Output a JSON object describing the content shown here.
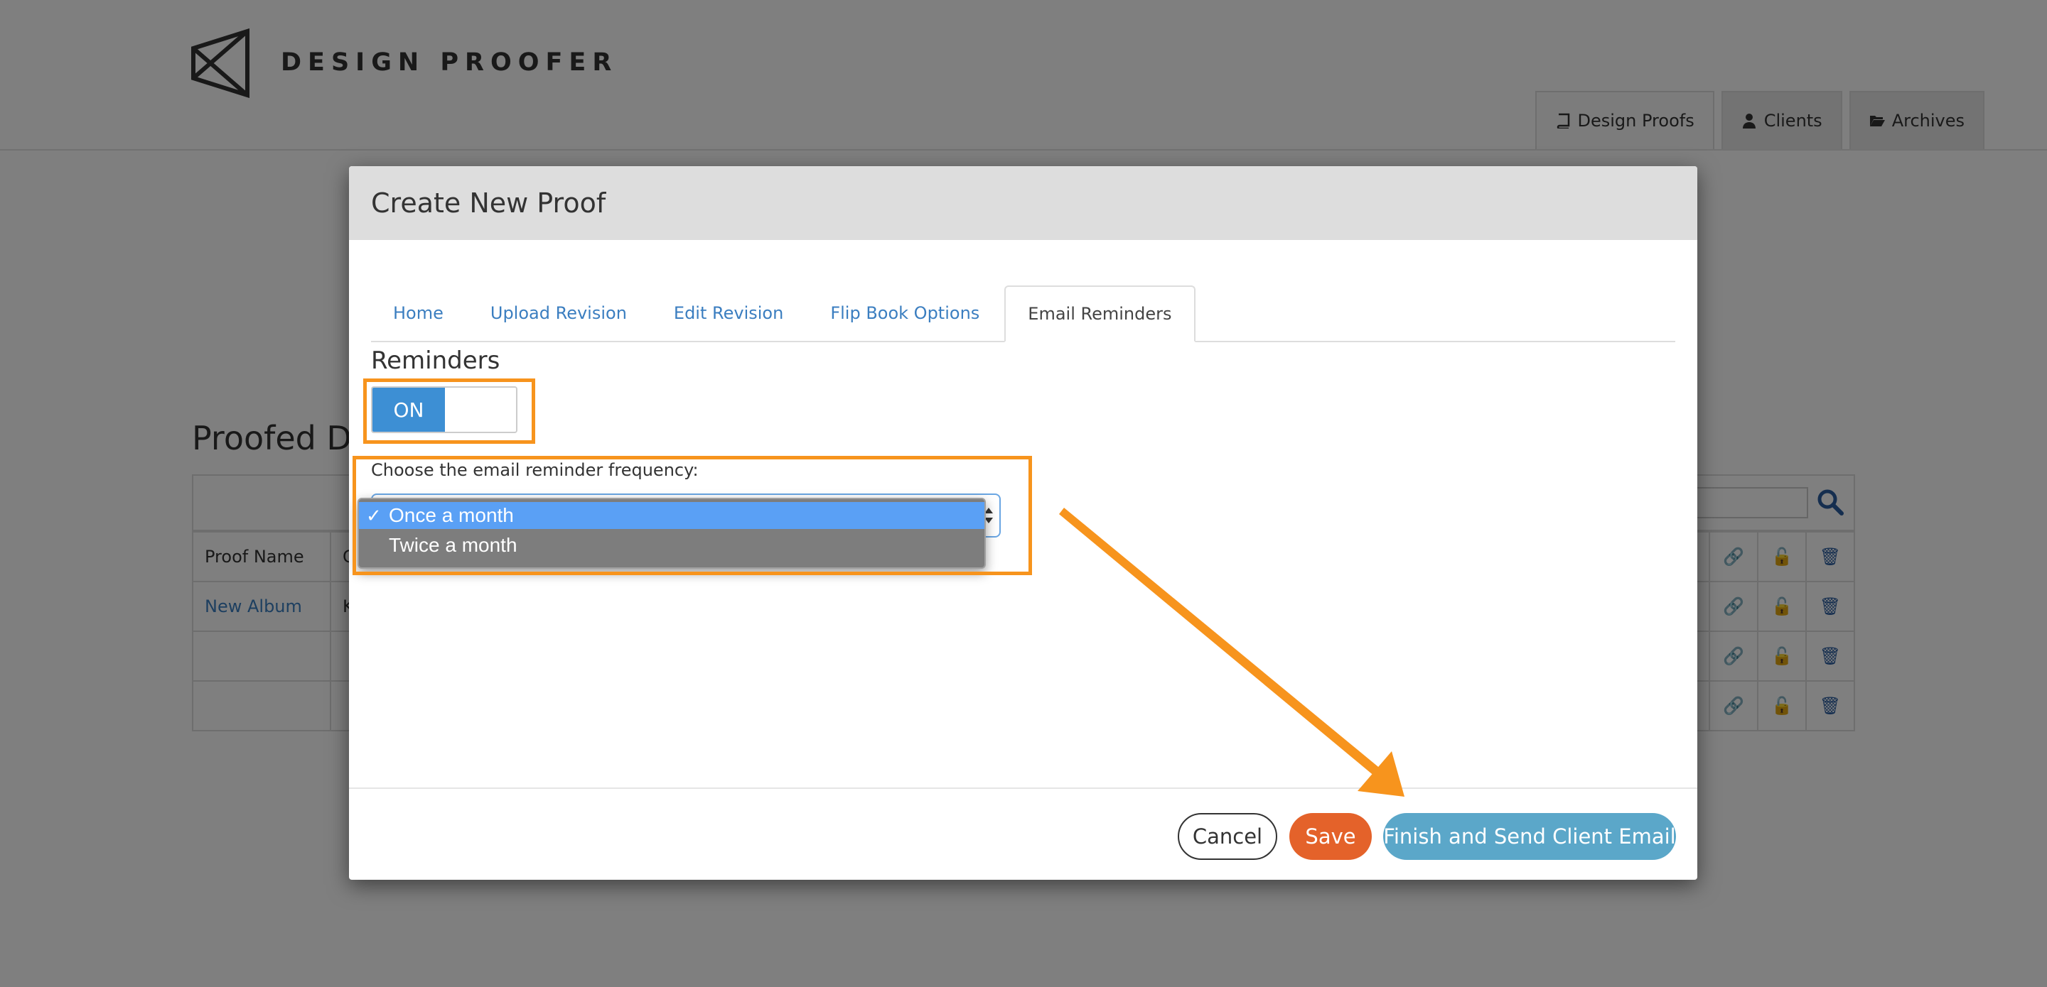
{
  "brand": {
    "name": "DESIGN PROOFER"
  },
  "nav": {
    "tabs": [
      {
        "label": "Design Proofs",
        "icon": "book-icon",
        "active": true
      },
      {
        "label": "Clients",
        "icon": "user-icon",
        "active": false
      },
      {
        "label": "Archives",
        "icon": "folder-open-icon",
        "active": false
      }
    ]
  },
  "background": {
    "section_title": "Proofed D",
    "table": {
      "header_first": "Proof Name",
      "header_second_partial": "C",
      "rows": [
        {
          "name": "New Album",
          "second_partial": "K"
        }
      ]
    }
  },
  "modal": {
    "title": "Create New Proof",
    "tabs": [
      {
        "label": "Home",
        "active": false
      },
      {
        "label": "Upload Revision",
        "active": false
      },
      {
        "label": "Edit Revision",
        "active": false
      },
      {
        "label": "Flip Book Options",
        "active": false
      },
      {
        "label": "Email Reminders",
        "active": true
      }
    ],
    "reminders_label": "Reminders",
    "toggle": {
      "on_label": "ON",
      "state": "on"
    },
    "frequency_label": "Choose the email reminder frequency:",
    "frequency_select": {
      "selected": "Once a month",
      "options": [
        "Once a month",
        "Twice a month"
      ],
      "check_mark": "✓"
    },
    "footer": {
      "cancel_label": "Cancel",
      "save_label": "Save",
      "finish_label": "Finish and Send Client Email"
    }
  },
  "colors": {
    "accent_blue": "#3d8fd4",
    "save_orange": "#e4622a",
    "finish_blue": "#5ba7c9",
    "annotation_orange": "#f7941d",
    "link_blue": "#3b7ec0"
  }
}
